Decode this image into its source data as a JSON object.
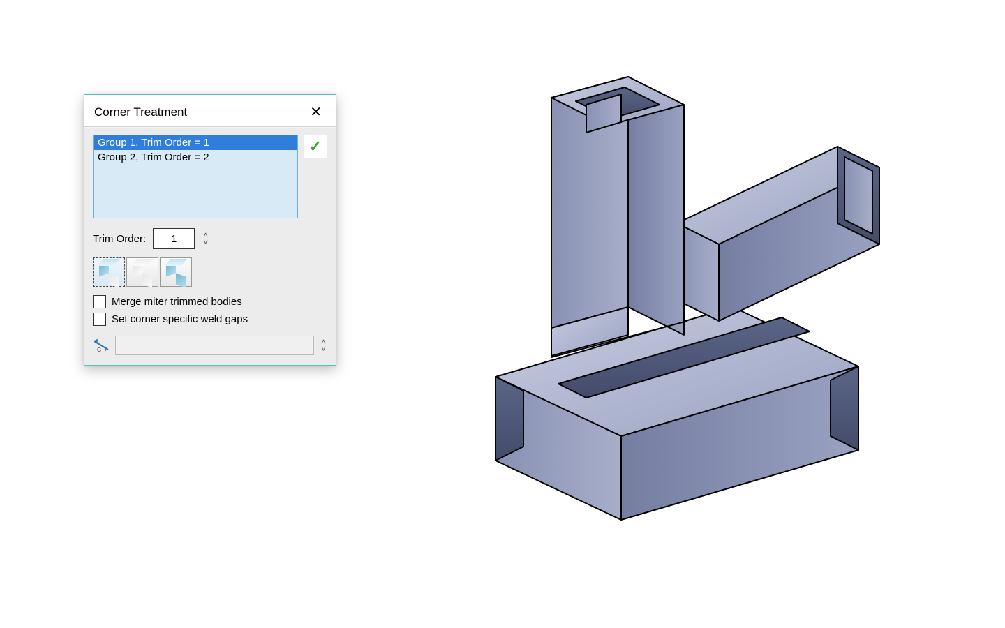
{
  "dialog": {
    "title": "Corner Treatment",
    "groups": {
      "items": [
        {
          "label": "Group 1, Trim Order = 1",
          "selected": true
        },
        {
          "label": "Group 2, Trim Order = 2",
          "selected": false
        }
      ]
    },
    "trim_order_label": "Trim Order:",
    "trim_order_value": "1",
    "corner_type_icons": [
      {
        "name": "corner-type-1",
        "selected": true
      },
      {
        "name": "corner-type-2",
        "selected": false
      },
      {
        "name": "corner-type-3",
        "selected": false
      }
    ],
    "merge_label": "Merge miter trimmed bodies",
    "merge_checked": false,
    "weldgap_label": "Set corner specific weld gaps",
    "weldgap_checked": false,
    "gap_value": ""
  },
  "colors": {
    "accent": "#54c5b5",
    "selection": "#2f7edb",
    "steel_light": "#b9bfd6",
    "steel_mid": "#8d96b6",
    "steel_dark": "#5a6380"
  }
}
